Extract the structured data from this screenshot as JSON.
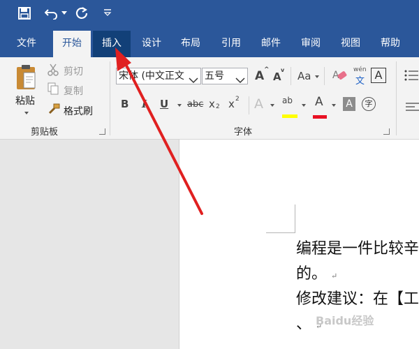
{
  "quick_access": {
    "save": "save-icon",
    "undo": "undo-icon",
    "redo": "redo-icon",
    "customize": "customize-icon"
  },
  "tabs": [
    "文件",
    "开始",
    "插入",
    "设计",
    "布局",
    "引用",
    "邮件",
    "审阅",
    "视图",
    "帮助"
  ],
  "active_tab": "开始",
  "clipboard": {
    "paste_label": "粘贴",
    "cut_label": "剪切",
    "copy_label": "复制",
    "format_painter_label": "格式刷",
    "group_label": "剪贴板"
  },
  "font": {
    "font_name": "宋体 (中文正文",
    "font_size": "五号",
    "grow_label": "A",
    "shrink_label": "A",
    "case_label": "Aa",
    "phonetic_top": "wén",
    "phonetic_bottom": "文",
    "border_char_label": "A",
    "bold_label": "B",
    "italic_label": "I",
    "underline_label": "U",
    "strike_label": "abc",
    "subscript_label": "x",
    "subscript_small": "2",
    "superscript_label": "x",
    "superscript_small": "2",
    "effects_label": "A",
    "highlight_label": "ab",
    "font_color_label": "A",
    "shading_label": "A",
    "enclose_label": "字",
    "group_label": "字体"
  },
  "colors": {
    "title_bar": "#2b579a",
    "highlight": "#ffff00",
    "font_color": "#e81123",
    "arrow": "#e02020"
  },
  "document": {
    "lines": [
      "编程是一件比较辛",
      "的。",
      "修改建议：在【工",
      "、"
    ],
    "paragraph_mark": "↵"
  },
  "watermark": "Baidu经验"
}
